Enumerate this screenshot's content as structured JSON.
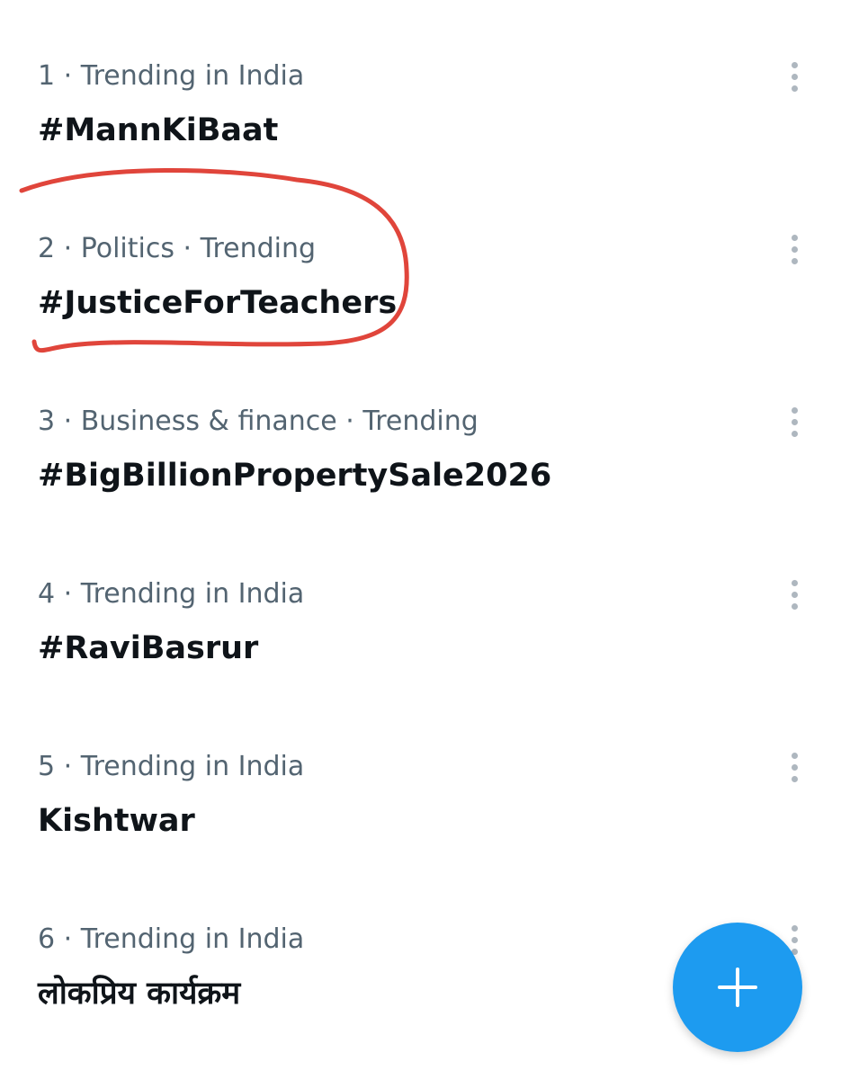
{
  "trends": [
    {
      "meta": "1 · Trending in India",
      "title": "#MannKiBaat"
    },
    {
      "meta": "2 · Politics · Trending",
      "title": "#JusticeForTeachers"
    },
    {
      "meta": "3 · Business & finance · Trending",
      "title": "#BigBillionPropertySale2026"
    },
    {
      "meta": "4 · Trending in India",
      "title": "#RaviBasrur"
    },
    {
      "meta": "5 · Trending in India",
      "title": "Kishtwar"
    },
    {
      "meta": "6 · Trending in India",
      "title": "लोकप्रिय कार्यक्रम"
    }
  ],
  "icons": {
    "more": "more-vertical-icon",
    "compose": "plus-icon"
  },
  "colors": {
    "meta_text": "#536471",
    "title_text": "#0f1419",
    "more_dots": "#aeb7bf",
    "fab": "#1d9bf0",
    "annotation": "#e0453b"
  }
}
